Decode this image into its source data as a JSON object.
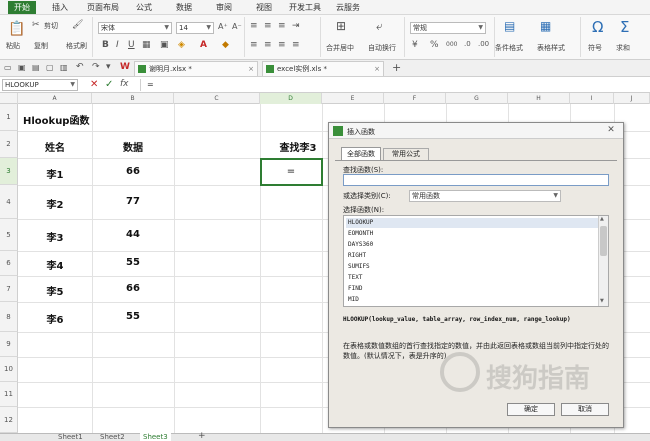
{
  "menu": {
    "tabs": [
      "开始",
      "插入",
      "页面布局",
      "公式",
      "数据",
      "审阅",
      "视图",
      "开发工具",
      "云服务"
    ],
    "active_color": "#2e7d32"
  },
  "ribbon": {
    "cut": "剪切",
    "paste": "粘贴",
    "copy": "复制",
    "format_painter": "格式刷",
    "font_name": "宋体",
    "font_size": "14",
    "merge_center": "合并居中",
    "wrap_text": "自动换行",
    "number_format": "常规",
    "conditional_format": "条件格式",
    "table_style": "表格样式",
    "symbol": "符号",
    "sum": "求和",
    "bold": "B",
    "italic": "I",
    "underline": "U",
    "omega": "Ω",
    "sigma": "Σ",
    "percent": "%",
    "comma": "000"
  },
  "doc_tabs": [
    "谢明月.xlsx *",
    "excel实例.xls *"
  ],
  "formula_bar": {
    "name_box": "HLOOKUP",
    "fx": "fx",
    "content": "="
  },
  "columns": [
    "A",
    "B",
    "C",
    "D",
    "E",
    "F",
    "G",
    "H",
    "I",
    "J"
  ],
  "rows": [
    "1",
    "2",
    "3",
    "4",
    "5",
    "6",
    "7",
    "8",
    "9",
    "10",
    "11",
    "12",
    "13"
  ],
  "cells": {
    "a1": "Hlookup函数",
    "a2": "姓名",
    "b2": "数据",
    "d2": "查找李3",
    "d3": "=",
    "names": [
      "李1",
      "李2",
      "李3",
      "李4",
      "李5",
      "李6"
    ],
    "values": [
      "66",
      "77",
      "44",
      "55",
      "66",
      "55"
    ]
  },
  "sheet_tabs": [
    "Sheet1",
    "Sheet2",
    "Sheet3"
  ],
  "dialog": {
    "title": "插入函数",
    "tab_all": "全部函数",
    "tab_common": "常用公式",
    "search_label": "查找函数(S):",
    "category_label": "或选择类别(C):",
    "category_value": "常用函数",
    "list_label": "选择函数(N):",
    "functions": [
      "HLOOKUP",
      "EOMONTH",
      "DAYS360",
      "RIGHT",
      "SUMIFS",
      "TEXT",
      "FIND",
      "MID"
    ],
    "selected_function": "HLOOKUP",
    "signature": "HLOOKUP(lookup_value, table_array, row_index_num, range_lookup)",
    "description": "在表格或数值数组的首行查找指定的数值，并由此返回表格或数组当前列中指定行处的数值。(默认情况下，表是升序的)",
    "ok": "确定",
    "cancel": "取消"
  },
  "watermark": "搜狗指南"
}
